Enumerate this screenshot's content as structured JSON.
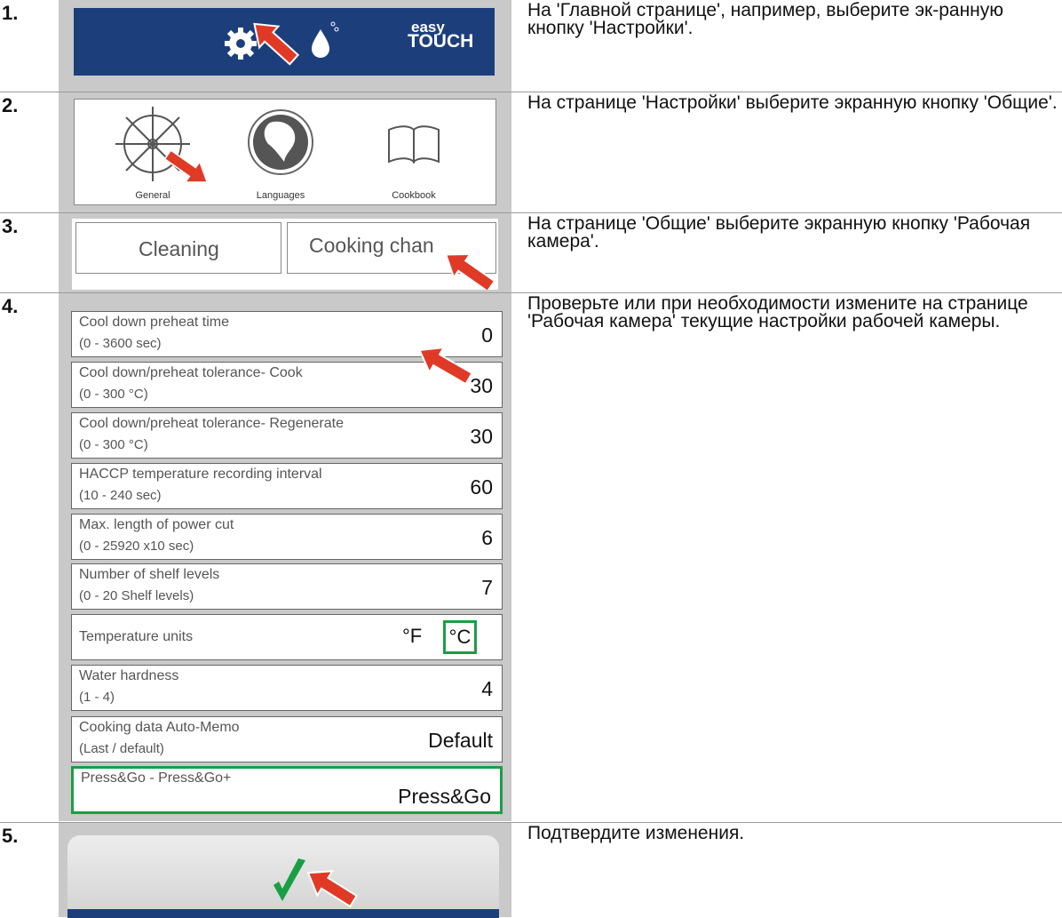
{
  "steps": [
    {
      "num": "1.",
      "text": "На 'Главной странице', например, выберите эк-ранную кнопку 'Настройки'."
    },
    {
      "num": "2.",
      "text": "На странице 'Настройки' выберите экранную кнопку 'Общие'."
    },
    {
      "num": "3.",
      "text": "На странице 'Общие' выберите экранную кнопку 'Рабочая камера'."
    },
    {
      "num": "4.",
      "text": "Проверьте или при необходимости измените на странице 'Рабочая камера' текущие настройки рабочей камеры."
    },
    {
      "num": "5.",
      "text": "Подтвердите изменения."
    }
  ],
  "easytouch": {
    "logo_top": "easy",
    "logo_bottom": "TOUCH"
  },
  "settings_menu": {
    "general": "General",
    "languages": "Languages",
    "cookbook": "Cookbook"
  },
  "general_tabs": {
    "cleaning": "Cleaning",
    "cooking_chamber": "Cooking chan"
  },
  "chamber_settings": [
    {
      "label": "Cool down preheat time",
      "range": "(0 - 3600 sec)",
      "value": "0"
    },
    {
      "label": "Cool down/preheat tolerance- Cook",
      "range": "(0 - 300 °C)",
      "value": "30"
    },
    {
      "label": "Cool down/preheat tolerance- Regenerate",
      "range": "(0 - 300 °C)",
      "value": "30"
    },
    {
      "label": "HACCP temperature recording interval",
      "range": "(10 - 240 sec)",
      "value": "60"
    },
    {
      "label": "Max. length of power cut",
      "range": "(0 - 25920 x10 sec)",
      "value": "6"
    },
    {
      "label": "Number of shelf levels",
      "range": "(0 - 20 Shelf levels)",
      "value": "7"
    },
    {
      "label": "Temperature units",
      "option_f": "°F",
      "option_c": "°C",
      "selected": "°C"
    },
    {
      "label": "Water hardness",
      "range": "(1 - 4)",
      "value": "4"
    },
    {
      "label": "Cooking data Auto-Memo",
      "range": "(Last / default)",
      "value": "Default"
    },
    {
      "label": "Press&Go - Press&Go+",
      "value": "Press&Go"
    }
  ],
  "colors": {
    "brand_blue": "#1c3f7c",
    "selection_green": "#1a9e45",
    "arrow_red": "#e03a26",
    "confirm_green": "#1a9e45"
  }
}
